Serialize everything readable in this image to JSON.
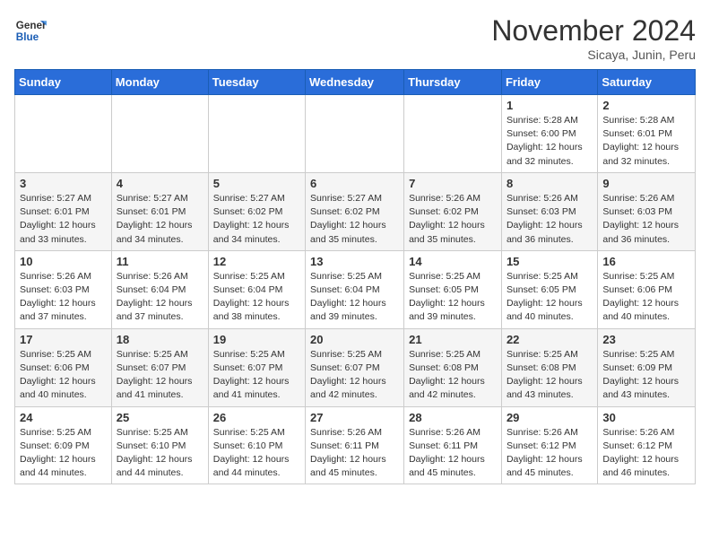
{
  "header": {
    "logo": {
      "general": "General",
      "blue": "Blue"
    },
    "title": "November 2024",
    "location": "Sicaya, Junin, Peru"
  },
  "calendar": {
    "days_of_week": [
      "Sunday",
      "Monday",
      "Tuesday",
      "Wednesday",
      "Thursday",
      "Friday",
      "Saturday"
    ],
    "weeks": [
      [
        {
          "day": "",
          "info": ""
        },
        {
          "day": "",
          "info": ""
        },
        {
          "day": "",
          "info": ""
        },
        {
          "day": "",
          "info": ""
        },
        {
          "day": "",
          "info": ""
        },
        {
          "day": "1",
          "info": "Sunrise: 5:28 AM\nSunset: 6:00 PM\nDaylight: 12 hours and 32 minutes."
        },
        {
          "day": "2",
          "info": "Sunrise: 5:28 AM\nSunset: 6:01 PM\nDaylight: 12 hours and 32 minutes."
        }
      ],
      [
        {
          "day": "3",
          "info": "Sunrise: 5:27 AM\nSunset: 6:01 PM\nDaylight: 12 hours and 33 minutes."
        },
        {
          "day": "4",
          "info": "Sunrise: 5:27 AM\nSunset: 6:01 PM\nDaylight: 12 hours and 34 minutes."
        },
        {
          "day": "5",
          "info": "Sunrise: 5:27 AM\nSunset: 6:02 PM\nDaylight: 12 hours and 34 minutes."
        },
        {
          "day": "6",
          "info": "Sunrise: 5:27 AM\nSunset: 6:02 PM\nDaylight: 12 hours and 35 minutes."
        },
        {
          "day": "7",
          "info": "Sunrise: 5:26 AM\nSunset: 6:02 PM\nDaylight: 12 hours and 35 minutes."
        },
        {
          "day": "8",
          "info": "Sunrise: 5:26 AM\nSunset: 6:03 PM\nDaylight: 12 hours and 36 minutes."
        },
        {
          "day": "9",
          "info": "Sunrise: 5:26 AM\nSunset: 6:03 PM\nDaylight: 12 hours and 36 minutes."
        }
      ],
      [
        {
          "day": "10",
          "info": "Sunrise: 5:26 AM\nSunset: 6:03 PM\nDaylight: 12 hours and 37 minutes."
        },
        {
          "day": "11",
          "info": "Sunrise: 5:26 AM\nSunset: 6:04 PM\nDaylight: 12 hours and 37 minutes."
        },
        {
          "day": "12",
          "info": "Sunrise: 5:25 AM\nSunset: 6:04 PM\nDaylight: 12 hours and 38 minutes."
        },
        {
          "day": "13",
          "info": "Sunrise: 5:25 AM\nSunset: 6:04 PM\nDaylight: 12 hours and 39 minutes."
        },
        {
          "day": "14",
          "info": "Sunrise: 5:25 AM\nSunset: 6:05 PM\nDaylight: 12 hours and 39 minutes."
        },
        {
          "day": "15",
          "info": "Sunrise: 5:25 AM\nSunset: 6:05 PM\nDaylight: 12 hours and 40 minutes."
        },
        {
          "day": "16",
          "info": "Sunrise: 5:25 AM\nSunset: 6:06 PM\nDaylight: 12 hours and 40 minutes."
        }
      ],
      [
        {
          "day": "17",
          "info": "Sunrise: 5:25 AM\nSunset: 6:06 PM\nDaylight: 12 hours and 40 minutes."
        },
        {
          "day": "18",
          "info": "Sunrise: 5:25 AM\nSunset: 6:07 PM\nDaylight: 12 hours and 41 minutes."
        },
        {
          "day": "19",
          "info": "Sunrise: 5:25 AM\nSunset: 6:07 PM\nDaylight: 12 hours and 41 minutes."
        },
        {
          "day": "20",
          "info": "Sunrise: 5:25 AM\nSunset: 6:07 PM\nDaylight: 12 hours and 42 minutes."
        },
        {
          "day": "21",
          "info": "Sunrise: 5:25 AM\nSunset: 6:08 PM\nDaylight: 12 hours and 42 minutes."
        },
        {
          "day": "22",
          "info": "Sunrise: 5:25 AM\nSunset: 6:08 PM\nDaylight: 12 hours and 43 minutes."
        },
        {
          "day": "23",
          "info": "Sunrise: 5:25 AM\nSunset: 6:09 PM\nDaylight: 12 hours and 43 minutes."
        }
      ],
      [
        {
          "day": "24",
          "info": "Sunrise: 5:25 AM\nSunset: 6:09 PM\nDaylight: 12 hours and 44 minutes."
        },
        {
          "day": "25",
          "info": "Sunrise: 5:25 AM\nSunset: 6:10 PM\nDaylight: 12 hours and 44 minutes."
        },
        {
          "day": "26",
          "info": "Sunrise: 5:25 AM\nSunset: 6:10 PM\nDaylight: 12 hours and 44 minutes."
        },
        {
          "day": "27",
          "info": "Sunrise: 5:26 AM\nSunset: 6:11 PM\nDaylight: 12 hours and 45 minutes."
        },
        {
          "day": "28",
          "info": "Sunrise: 5:26 AM\nSunset: 6:11 PM\nDaylight: 12 hours and 45 minutes."
        },
        {
          "day": "29",
          "info": "Sunrise: 5:26 AM\nSunset: 6:12 PM\nDaylight: 12 hours and 45 minutes."
        },
        {
          "day": "30",
          "info": "Sunrise: 5:26 AM\nSunset: 6:12 PM\nDaylight: 12 hours and 46 minutes."
        }
      ]
    ]
  }
}
